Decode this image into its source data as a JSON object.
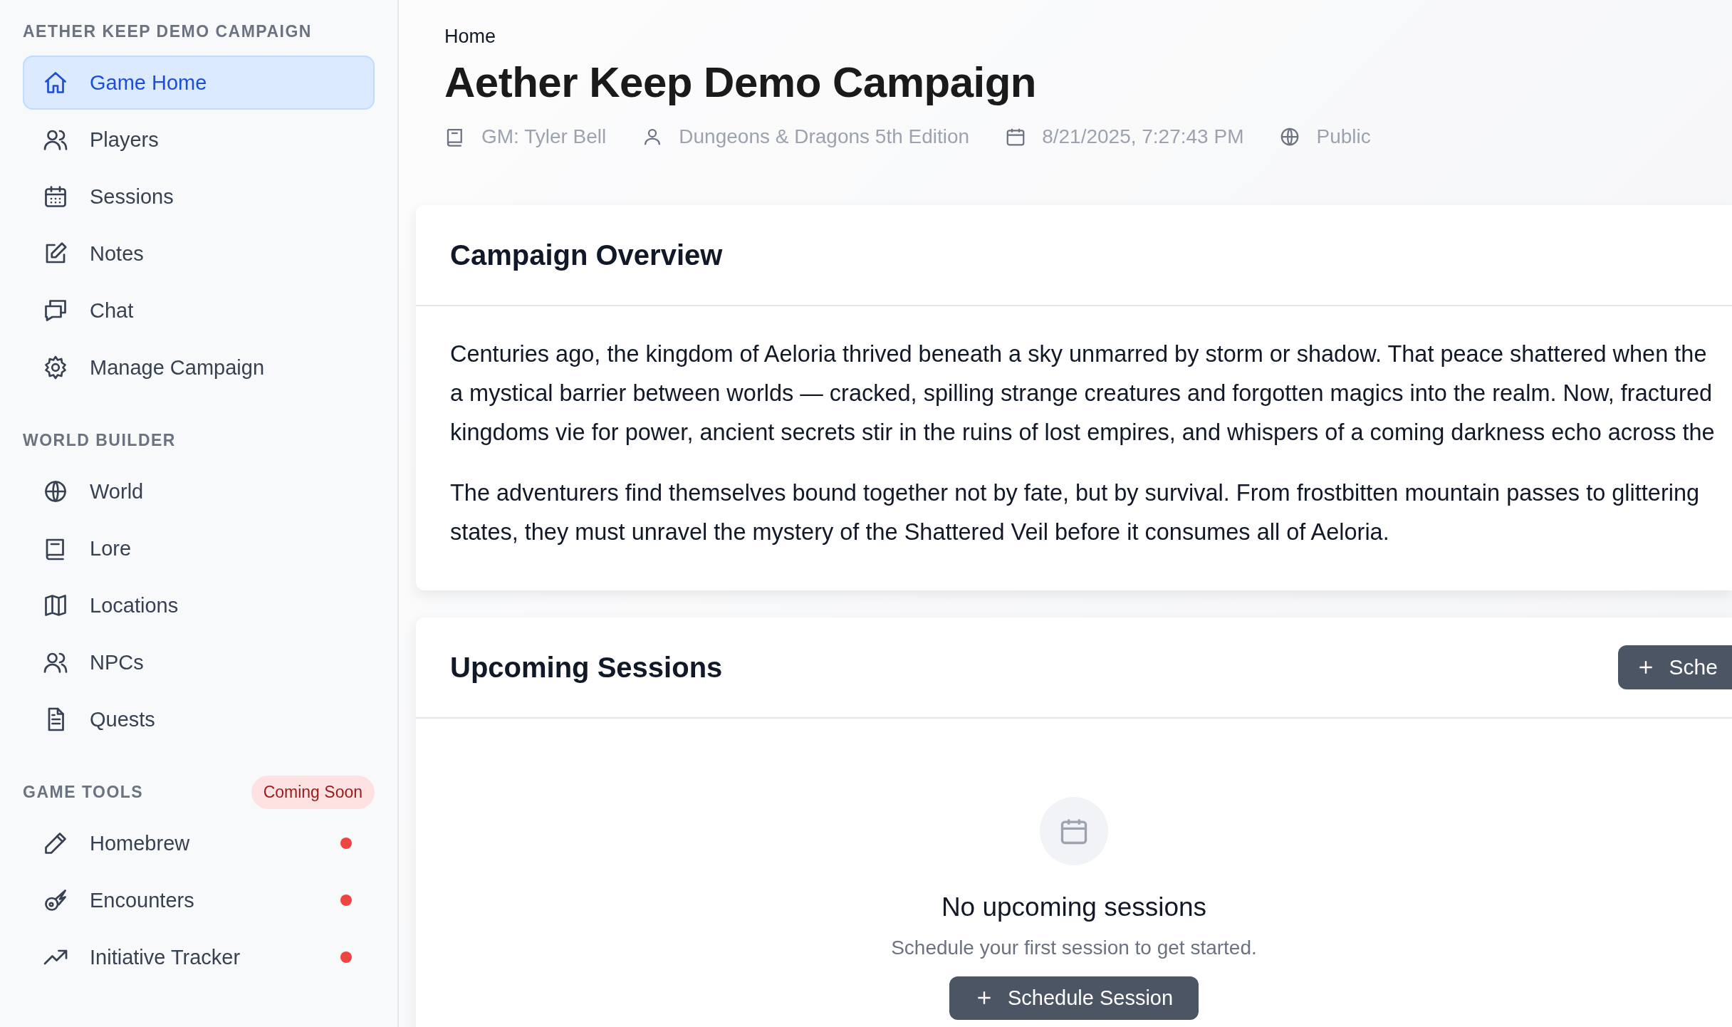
{
  "sidebar": {
    "sections": [
      {
        "title": "AETHER KEEP DEMO CAMPAIGN",
        "items": [
          {
            "label": "Game Home",
            "selected": true
          },
          {
            "label": "Players",
            "selected": false
          },
          {
            "label": "Sessions",
            "selected": false
          },
          {
            "label": "Notes",
            "selected": false
          },
          {
            "label": "Chat",
            "selected": false
          },
          {
            "label": "Manage Campaign",
            "selected": false
          }
        ]
      },
      {
        "title": "WORLD BUILDER",
        "items": [
          {
            "label": "World",
            "selected": false
          },
          {
            "label": "Lore",
            "selected": false
          },
          {
            "label": "Locations",
            "selected": false
          },
          {
            "label": "NPCs",
            "selected": false
          },
          {
            "label": "Quests",
            "selected": false
          }
        ]
      },
      {
        "title": "GAME TOOLS",
        "badge": "Coming Soon",
        "items": [
          {
            "label": "Homebrew",
            "selected": false,
            "dot": true
          },
          {
            "label": "Encounters",
            "selected": false,
            "dot": true
          },
          {
            "label": "Initiative Tracker",
            "selected": false,
            "dot": true
          }
        ]
      }
    ]
  },
  "breadcrumb": "Home",
  "title": "Aether Keep Demo Campaign",
  "meta": [
    "GM: Tyler Bell",
    "Dungeons & Dragons 5th Edition",
    "8/21/2025, 7:27:43 PM",
    "Public"
  ],
  "overview": {
    "title": "Campaign Overview",
    "paragraphs": [
      [
        "Centuries ago, the kingdom of Aeloria thrived beneath a sky unmarred by storm or shadow. That peace shattered when the",
        "a mystical barrier between worlds — cracked, spilling strange creatures and forgotten magics into the realm. Now, fractured",
        "kingdoms vie for power, ancient secrets stir in the ruins of lost empires, and whispers of a coming darkness echo across the"
      ],
      [
        "The adventurers find themselves bound together not by fate, but by survival. From frostbitten mountain passes to glittering",
        "states, they must unravel the mystery of the Shattered Veil before it consumes all of Aeloria."
      ]
    ]
  },
  "sessions": {
    "title": "Upcoming Sessions",
    "header_button": "Sche",
    "empty_title": "No upcoming sessions",
    "empty_text": "Schedule your first session to get started.",
    "empty_button": "Schedule Session"
  }
}
